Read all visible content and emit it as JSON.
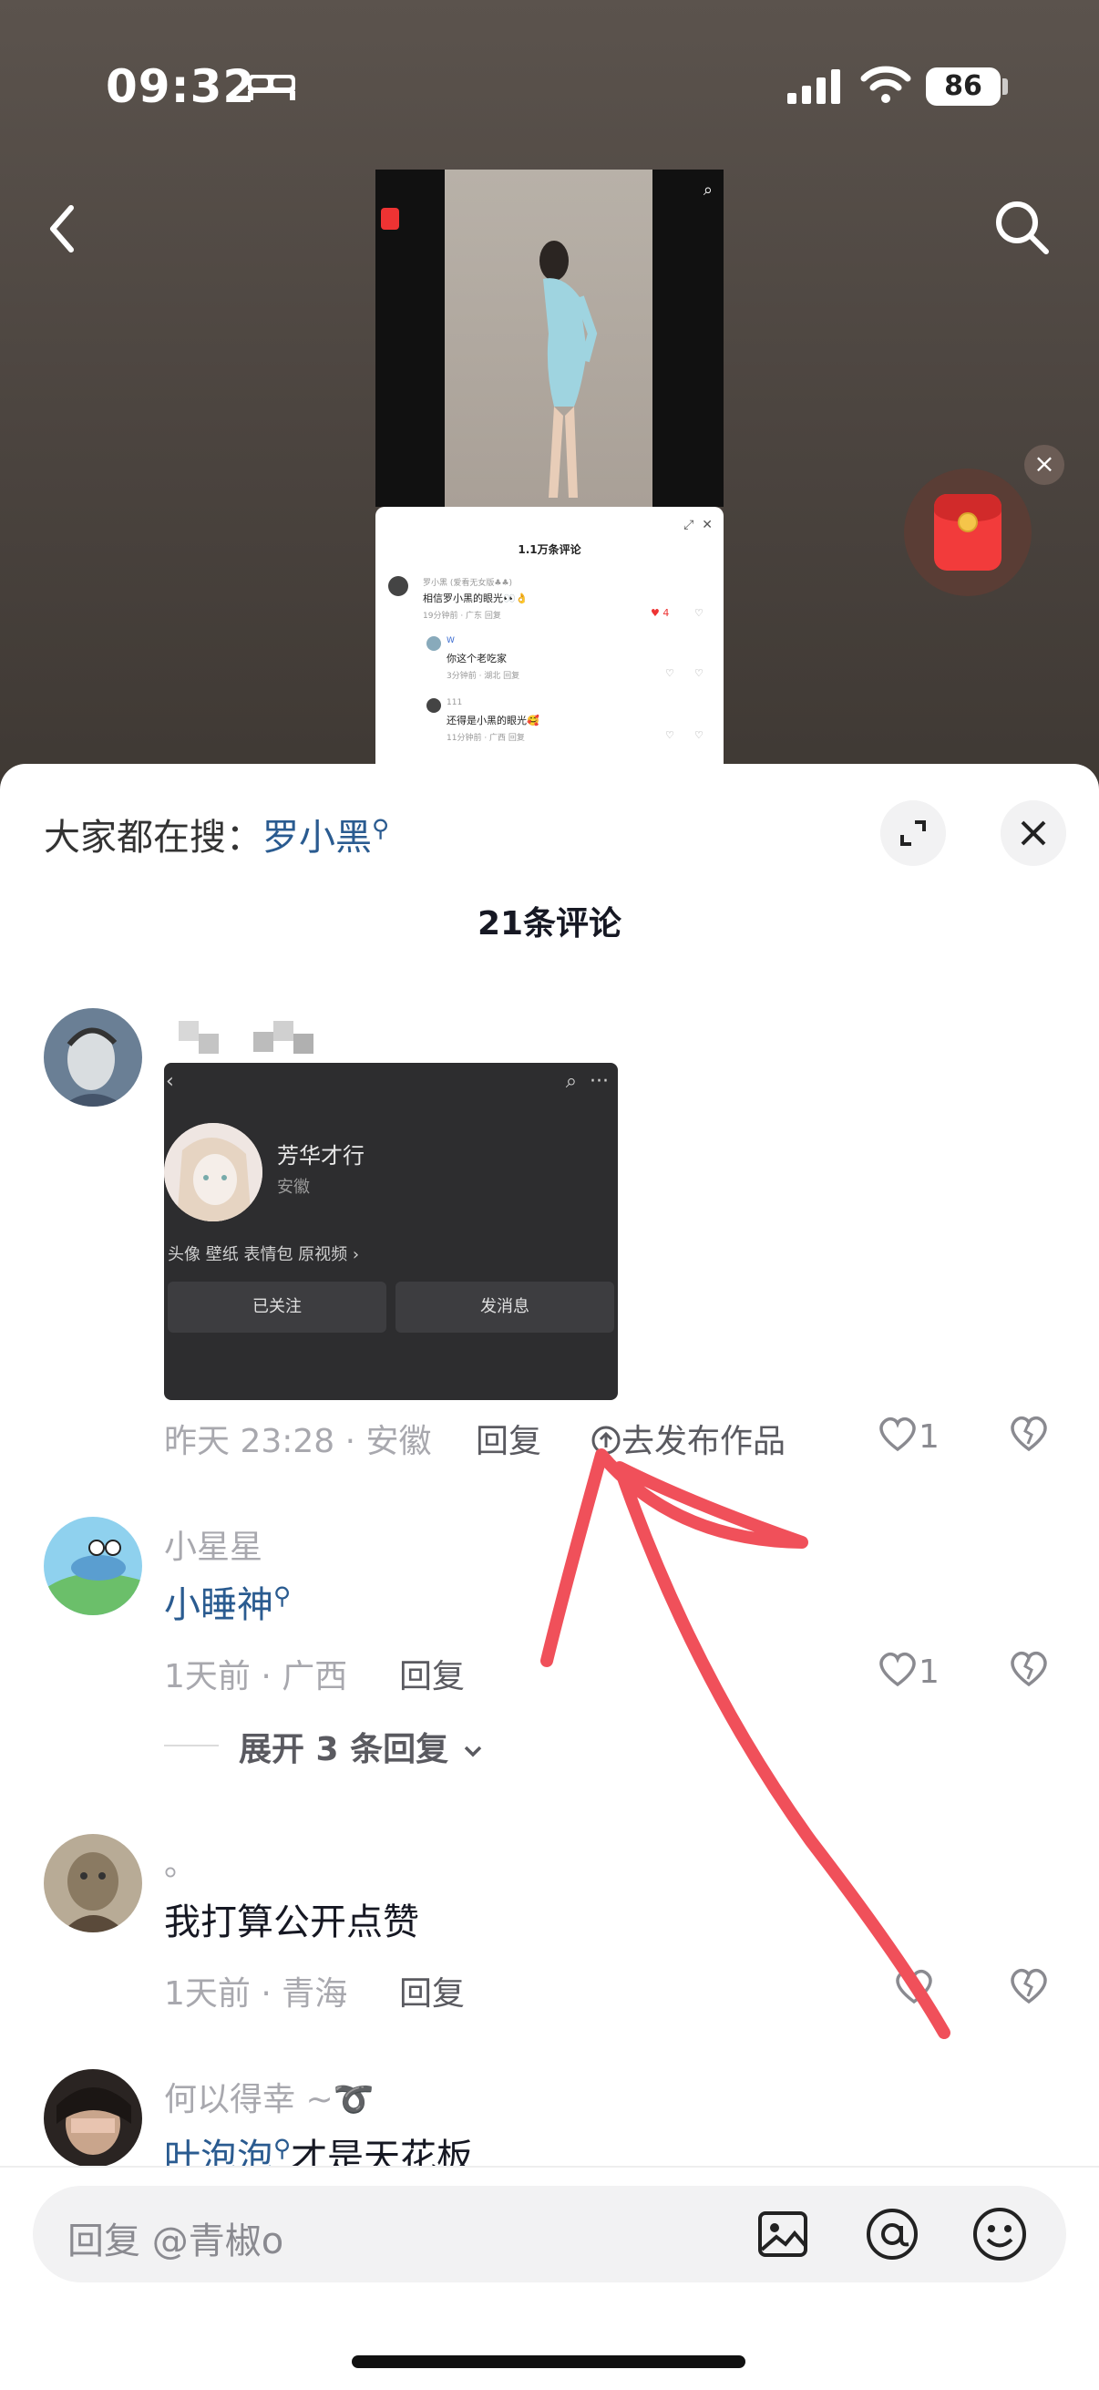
{
  "status": {
    "time": "09:32",
    "battery": "86"
  },
  "video_preview": {
    "comment_title": "1.1万条评论",
    "c1_name": "罗小黑 (爱看无女版♣♣)",
    "c1_text": "相信罗小黑的眼光👀👌",
    "c1_meta": "19分钟前 · 广东   回复",
    "c1_likes": "4",
    "c2_name": "W",
    "c2_text": "你这个老吃家",
    "c2_meta": "3分钟前 · 湖北   回复",
    "c3_name": "111",
    "c3_text": "还得是小黑的眼光🥰",
    "c3_meta": "11分钟前 · 广西   回复"
  },
  "sheet": {
    "search_prefix": "大家都在搜：",
    "search_keyword": "罗小黑",
    "count_title": "21条评论"
  },
  "comments": [
    {
      "screenshot": {
        "name": "芳华才行",
        "location": "安徽",
        "tags": "头像 壁纸 表情包 原视频 ›",
        "btn_followed": "已关注",
        "btn_message": "发消息"
      },
      "meta": "昨天 23:28 · 安徽",
      "reply": "回复",
      "publish": "去发布作品",
      "likes": "1"
    },
    {
      "user": "小星星",
      "text_link": "小睡神",
      "meta": "1天前 · 广西",
      "reply": "回复",
      "likes": "1",
      "expand": "展开 3 条回复"
    },
    {
      "user": "。",
      "text": "我打算公开点赞",
      "meta": "1天前 · 青海",
      "reply": "回复"
    },
    {
      "user": "何以得幸 ~➰",
      "text_link": "叶泡泡",
      "text_rest": "才是天花板"
    }
  ],
  "input": {
    "placeholder": "回复 @青椒o"
  },
  "colors": {
    "accent_link": "#2a5b90",
    "annotation_red": "#f0505a",
    "sheet_bg": "#ffffff"
  }
}
